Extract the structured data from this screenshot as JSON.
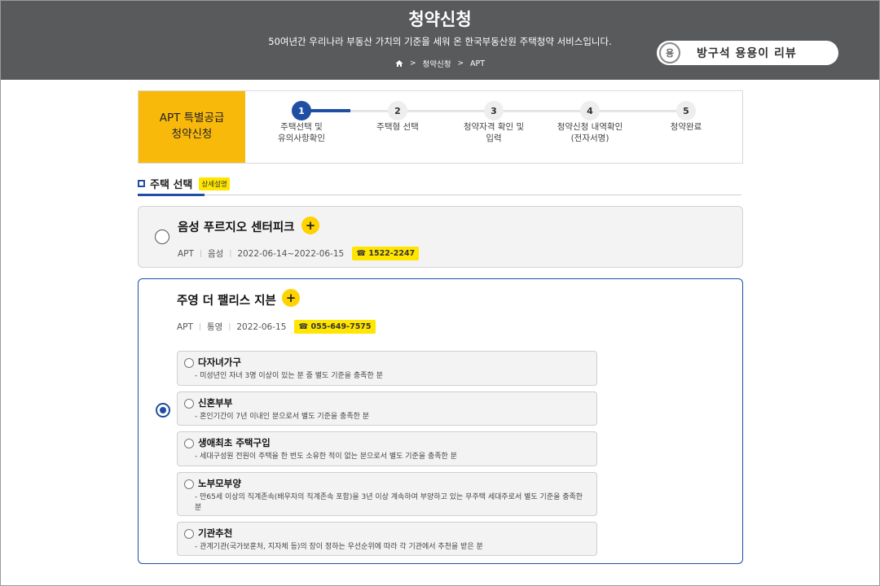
{
  "header": {
    "title": "청약신청",
    "subtitle": "50여년간 우리나라 부동산 가치의 기준을 세워 온 한국부동산원 주택청약 서비스입니다.",
    "breadcrumb": [
      "청약신청",
      "APT"
    ]
  },
  "watermark": {
    "circle": "용",
    "text": "방구석 용용이 리뷰"
  },
  "steps": {
    "label_line1": "APT 특별공급",
    "label_line2": "청약신청",
    "active": 1,
    "items": [
      {
        "num": "1",
        "line1": "주택선택 및",
        "line2": "유의사항확인"
      },
      {
        "num": "2",
        "line1": "주택형 선택",
        "line2": ""
      },
      {
        "num": "3",
        "line1": "청약자격 확인 및",
        "line2": "입력"
      },
      {
        "num": "4",
        "line1": "청약신청 내역확인",
        "line2": "(전자서명)"
      },
      {
        "num": "5",
        "line1": "청약완료",
        "line2": ""
      }
    ]
  },
  "section": {
    "title": "주택 선택",
    "tag": "상세설명"
  },
  "houses": [
    {
      "name": "음성 푸르지오 센터피크",
      "type": "APT",
      "region": "음성",
      "period": "2022-06-14~2022-06-15",
      "phone": "☎ 1522-2247",
      "selected": false
    },
    {
      "name": "주영 더 팰리스 지븐",
      "type": "APT",
      "region": "통영",
      "period": "2022-06-15",
      "phone": "☎ 055-649-7575",
      "selected": true
    }
  ],
  "options": [
    {
      "title": "다자녀가구",
      "desc": "- 미성년인 자녀 3명 이상이 있는 분 중 별도 기준을 충족한 분"
    },
    {
      "title": "신혼부부",
      "desc": "- 혼인기간이 7년 이내인 분으로서 별도 기준을 충족한 분"
    },
    {
      "title": "생애최초 주택구입",
      "desc": "- 세대구성원 전원이 주택을 한 번도 소유한 적이 없는 분으로서 별도 기준을 충족한 분"
    },
    {
      "title": "노부모부양",
      "desc": "- 만65세 이상의 직계존속(배우자의 직계존속 포함)을 3년 이상 계속하여 부양하고 있는 무주택 세대주로서 별도 기준을 충족한 분"
    },
    {
      "title": "기관추천",
      "desc": "- 관계기관(국가보훈처, 지자체 등)의 장이 정하는 우선순위에 따라 각 기관에서 추천을 받은 분"
    }
  ]
}
